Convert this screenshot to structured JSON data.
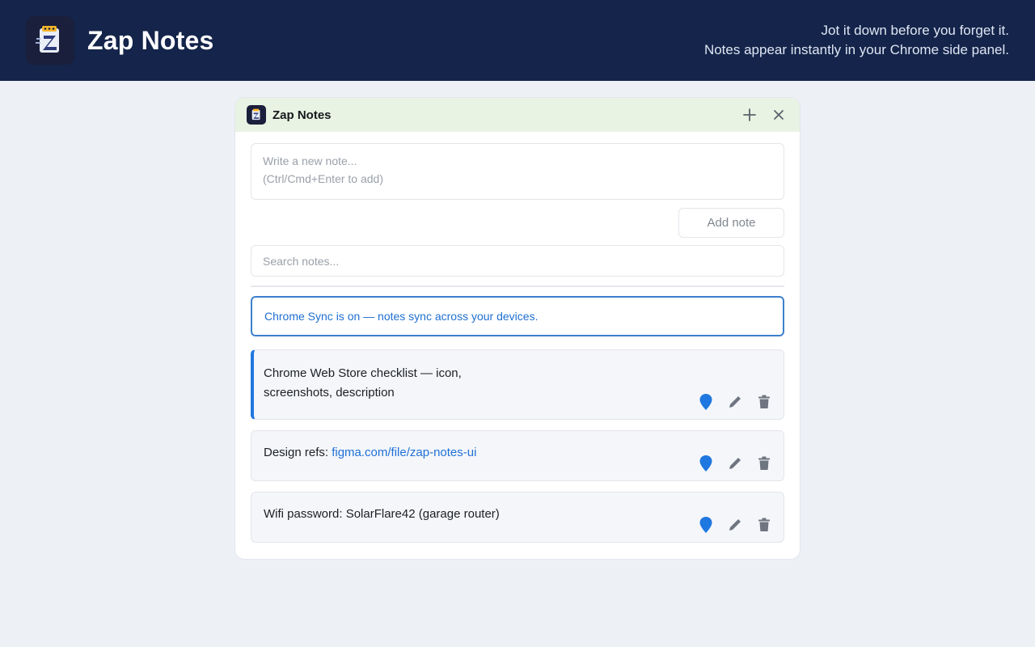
{
  "header": {
    "app_name": "Zap Notes",
    "tagline_line1": "Jot it down before you forget it.",
    "tagline_line2": "Notes appear instantly in your Chrome side panel."
  },
  "panel": {
    "title": "Zap Notes",
    "new_note_placeholder": "Write a new note...\n(Ctrl/Cmd+Enter to add)",
    "add_button": "Add note",
    "search_placeholder": "Search notes...",
    "sync_message": "Chrome Sync is on — notes sync across your devices."
  },
  "notes": [
    {
      "text": "Chrome Web Store checklist — icon, screenshots, description",
      "pinned": true
    },
    {
      "text": "Design refs: ",
      "link": "figma.com/file/zap-notes-ui",
      "pinned": false
    },
    {
      "text": "Wifi password: SolarFlare42 (garage router)",
      "pinned": false
    }
  ],
  "colors": {
    "header_bg": "#14244a",
    "panel_header_bg": "#e8f3e3",
    "accent": "#1f77e0",
    "pin": "#1f77e0",
    "icon_gray": "#6f7580"
  },
  "icons": [
    "zap-notes-logo",
    "plus-icon",
    "close-icon",
    "pin-icon",
    "pencil-icon",
    "trash-icon"
  ]
}
